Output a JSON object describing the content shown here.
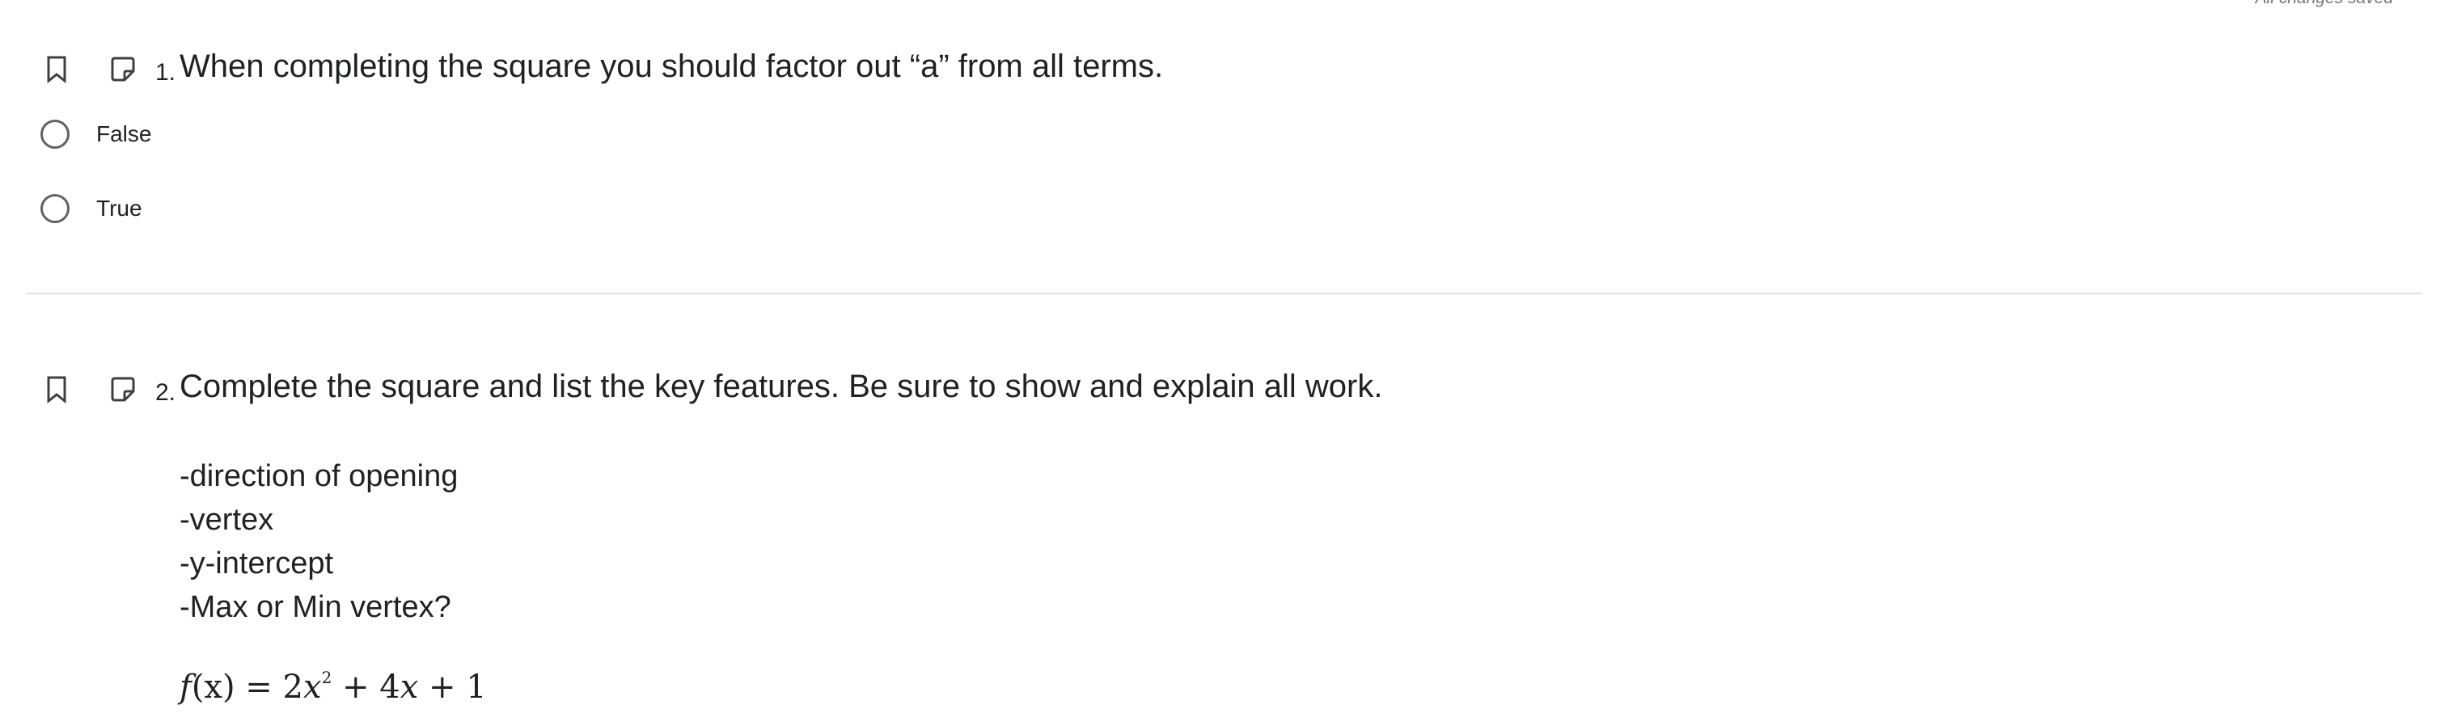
{
  "status": {
    "save_text": "All changes saved"
  },
  "icons": {
    "bookmark": "bookmark-icon",
    "note": "note-icon"
  },
  "questions": [
    {
      "number": "1.",
      "text": "When completing the square you should factor out “a” from all terms.",
      "choices": [
        {
          "label": "False",
          "selected": false
        },
        {
          "label": "True",
          "selected": false
        }
      ]
    },
    {
      "number": "2.",
      "text": "Complete the square and list the key features.  Be sure to show and explain all work.",
      "features": [
        "-direction of opening",
        "-vertex",
        "-y-intercept",
        "-Max or Min vertex?"
      ],
      "formula": {
        "lhs_fn": "f",
        "lhs_var": "(x)",
        "equals": " = 2",
        "var1": "x",
        "exp": "2",
        "rest_a": " + 4",
        "var2": "x",
        "rest_b": " + 1"
      }
    }
  ],
  "colors": {
    "text": "#202124",
    "icon": "#5f6368",
    "divider": "#e0e0e0",
    "status": "#757575"
  }
}
